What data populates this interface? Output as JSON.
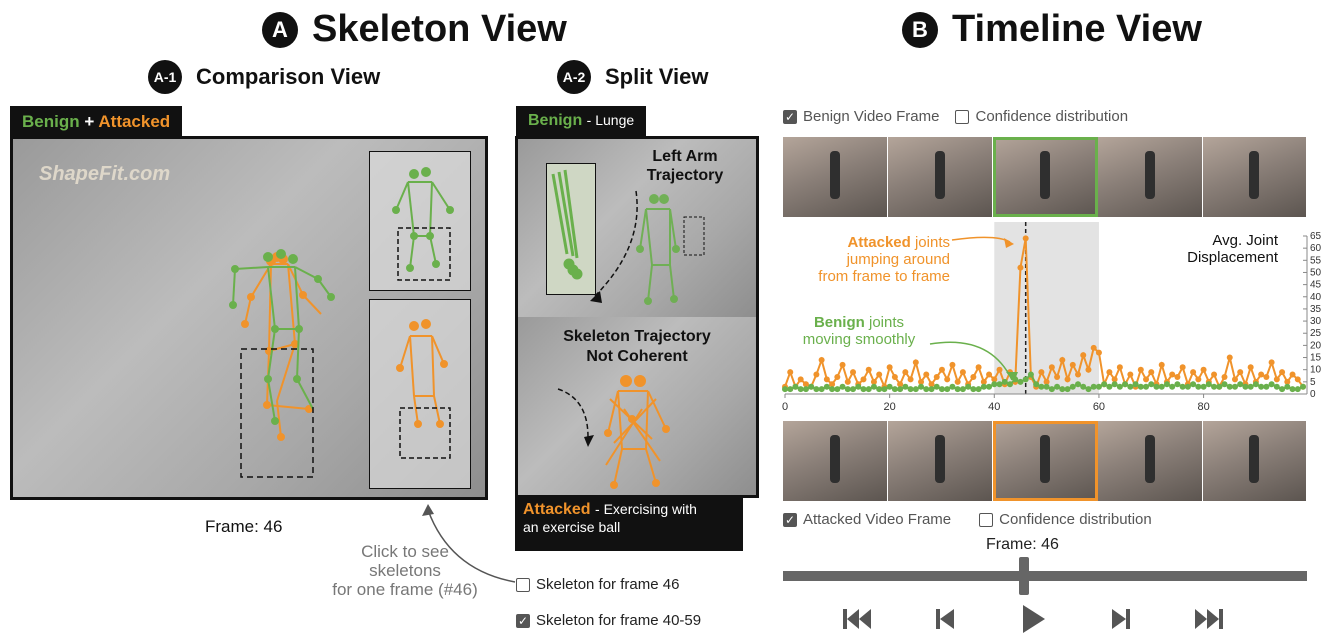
{
  "titles": {
    "a_badge": "A",
    "a_title": "Skeleton View",
    "b_badge": "B",
    "b_title": "Timeline View",
    "a1_badge": "A-1",
    "a1_title": "Comparison View",
    "a2_badge": "A-2",
    "a2_title": "Split View"
  },
  "comparison": {
    "tab_benign": "Benign",
    "tab_plus": "+",
    "tab_attacked": "Attacked",
    "watermark": "ShapeFit.com",
    "frame_label": "Frame: 46"
  },
  "annotation": {
    "click_hint": "Click to see\nskeletons\nfor one frame (#46)"
  },
  "split": {
    "benign_label": "Benign",
    "benign_desc": "- Lunge",
    "left_arm_label": "Left Arm\nTrajectory",
    "incoherent_label": "Skeleton Trajectory\nNot Coherent",
    "attacked_label": "Attacked",
    "attacked_desc": "- Exercising with\nan exercise ball",
    "option_single": "Skeleton for frame 46",
    "option_range": "Skeleton for frame 40-59",
    "option_single_checked": false,
    "option_range_checked": true
  },
  "timeline": {
    "benign_video_frame": "Benign Video Frame",
    "benign_conf_dist": "Confidence distribution",
    "attacked_video_frame": "Attacked Video Frame",
    "attacked_conf_dist": "Confidence distribution",
    "frame_label": "Frame: 46",
    "y_axis_label": "Avg. Joint\nDisplacement",
    "attacked_note_bold": "Attacked",
    "attacked_note_rest": "joints\njumping around\nfrom frame to frame",
    "benign_note_bold": "Benign",
    "benign_note_rest": "joints\nmoving smoothly",
    "controls": [
      "skip-back",
      "step-back",
      "play",
      "step-forward",
      "skip-forward"
    ],
    "slider_value": 0.46
  },
  "colors": {
    "benign": "#6ab04c",
    "attacked": "#f0932b"
  },
  "chart_data": {
    "type": "line",
    "xlabel": "",
    "ylabel": "Avg. Joint Displacement",
    "xlim": [
      0,
      99
    ],
    "ylim": [
      0,
      65
    ],
    "xticks": [
      0,
      20,
      40,
      60,
      80
    ],
    "yticks": [
      0,
      5,
      10,
      15,
      20,
      25,
      30,
      35,
      40,
      45,
      50,
      55,
      60,
      65
    ],
    "highlight_range": [
      40,
      60
    ],
    "marker_x": 46,
    "series": [
      {
        "name": "Attacked",
        "color": "#f0932b",
        "values": [
          3,
          9,
          3,
          6,
          4,
          3,
          8,
          14,
          6,
          4,
          7,
          12,
          5,
          9,
          4,
          6,
          10,
          5,
          8,
          3,
          11,
          7,
          4,
          9,
          6,
          13,
          5,
          8,
          4,
          7,
          10,
          6,
          12,
          5,
          9,
          4,
          7,
          11,
          5,
          8,
          6,
          10,
          4,
          9,
          5,
          52,
          64,
          7,
          3,
          9,
          5,
          11,
          7,
          14,
          6,
          12,
          8,
          16,
          10,
          19,
          17,
          4,
          9,
          6,
          11,
          4,
          8,
          3,
          10,
          6,
          9,
          4,
          12,
          5,
          8,
          7,
          11,
          4,
          9,
          6,
          10,
          5,
          8,
          3,
          7,
          15,
          6,
          9,
          4,
          11,
          5,
          8,
          7,
          13,
          6,
          9,
          5,
          8,
          6,
          3
        ]
      },
      {
        "name": "Benign",
        "color": "#6ab04c",
        "values": [
          2,
          2,
          3,
          2,
          2,
          3,
          2,
          2,
          3,
          2,
          2,
          3,
          2,
          2,
          3,
          2,
          2,
          3,
          2,
          2,
          3,
          2,
          2,
          3,
          2,
          2,
          3,
          2,
          2,
          3,
          2,
          2,
          3,
          2,
          2,
          3,
          2,
          2,
          3,
          3,
          4,
          4,
          5,
          4,
          6,
          5,
          6,
          8,
          4,
          3,
          3,
          2,
          3,
          2,
          2,
          3,
          4,
          3,
          2,
          3,
          3,
          4,
          3,
          4,
          3,
          4,
          3,
          4,
          3,
          3,
          4,
          3,
          3,
          4,
          3,
          4,
          3,
          3,
          4,
          3,
          3,
          4,
          3,
          3,
          4,
          3,
          3,
          4,
          3,
          3,
          4,
          3,
          3,
          4,
          3,
          2,
          3,
          2,
          2,
          3
        ]
      }
    ]
  }
}
